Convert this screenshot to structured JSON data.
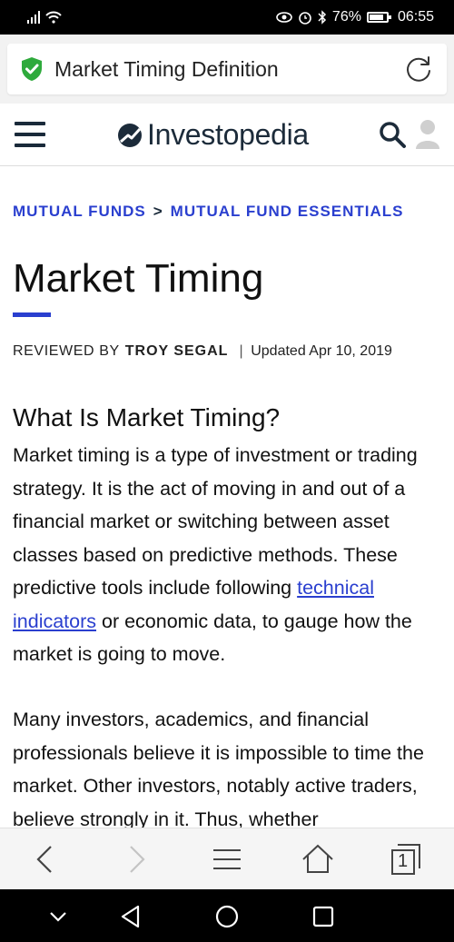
{
  "status_bar": {
    "battery": "76%",
    "time": "06:55",
    "battery_level": 0.76
  },
  "browser": {
    "page_title": "Market Timing Definition",
    "icons": [
      "shield-check-icon",
      "reload-icon"
    ]
  },
  "site_header": {
    "logo_text": "Investopedia",
    "icons": [
      "hamburger-menu-icon",
      "search-icon",
      "user-icon"
    ]
  },
  "article": {
    "breadcrumb": [
      "MUTUAL FUNDS",
      "MUTUAL FUND ESSENTIALS"
    ],
    "breadcrumb_separator": ">",
    "title": "Market Timing",
    "reviewed_by_label": "REVIEWED BY",
    "reviewer": "TROY SEGAL",
    "byline_divider": "|",
    "updated": "Updated Apr 10, 2019",
    "heading": "What Is Market Timing?",
    "paragraph1_before": "Market timing is a type of investment or trading strategy. It is the act of moving in and out of a financial market or switching between asset classes based on predictive methods. These predictive tools include following ",
    "paragraph1_link": "technical indicators",
    "paragraph1_after": " or economic data, to gauge how the market is going to move.",
    "paragraph2": "Many investors, academics, and financial professionals believe it is impossible to time the market. Other investors, notably active traders, believe strongly in it. Thus, whether"
  },
  "toolbar": {
    "tab_count": "1",
    "icons": [
      "back-icon",
      "forward-icon",
      "menu-icon",
      "home-icon",
      "tabs-icon"
    ]
  },
  "nav_bar": {
    "icons": [
      "nav-down-icon",
      "nav-back-icon",
      "nav-home-icon",
      "nav-recents-icon"
    ]
  },
  "colors": {
    "accent_blue": "#2a3fcf",
    "logo_dark": "#1c2b3a",
    "shield_green": "#2eaa3c"
  }
}
